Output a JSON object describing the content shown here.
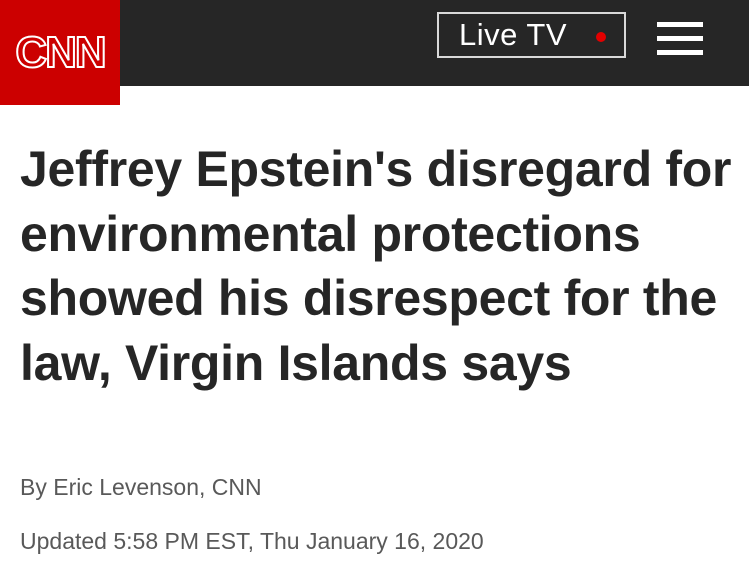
{
  "header": {
    "logo": "CNN",
    "live_label": "Live TV",
    "menu_icon": "hamburger-menu-icon",
    "live_indicator_color": "#e30000",
    "brand_color": "#cc0000",
    "bar_color": "#262626"
  },
  "article": {
    "headline": "Jeffrey Epstein's disregard for environmental protections showed his disrespect for the law, Virgin Islands says",
    "byline": "By Eric Levenson, CNN",
    "updated": "Updated 5:58 PM EST, Thu January 16, 2020"
  }
}
